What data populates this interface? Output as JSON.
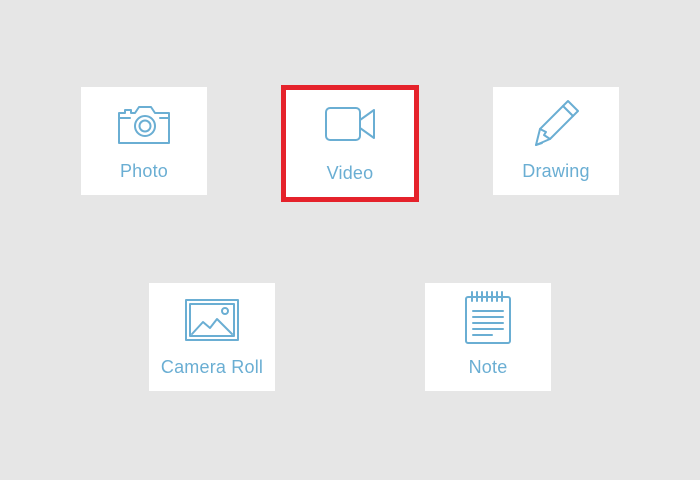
{
  "menu": {
    "items": [
      {
        "label": "Photo",
        "icon": "camera-icon"
      },
      {
        "label": "Video",
        "icon": "video-camera-icon",
        "selected": true
      },
      {
        "label": "Drawing",
        "icon": "pencil-icon"
      },
      {
        "label": "Camera Roll",
        "icon": "image-icon"
      },
      {
        "label": "Note",
        "icon": "notepad-icon"
      }
    ]
  },
  "colors": {
    "background": "#e6e6e6",
    "tile": "#ffffff",
    "accent": "#6aaed3",
    "selection": "#e5222b"
  }
}
